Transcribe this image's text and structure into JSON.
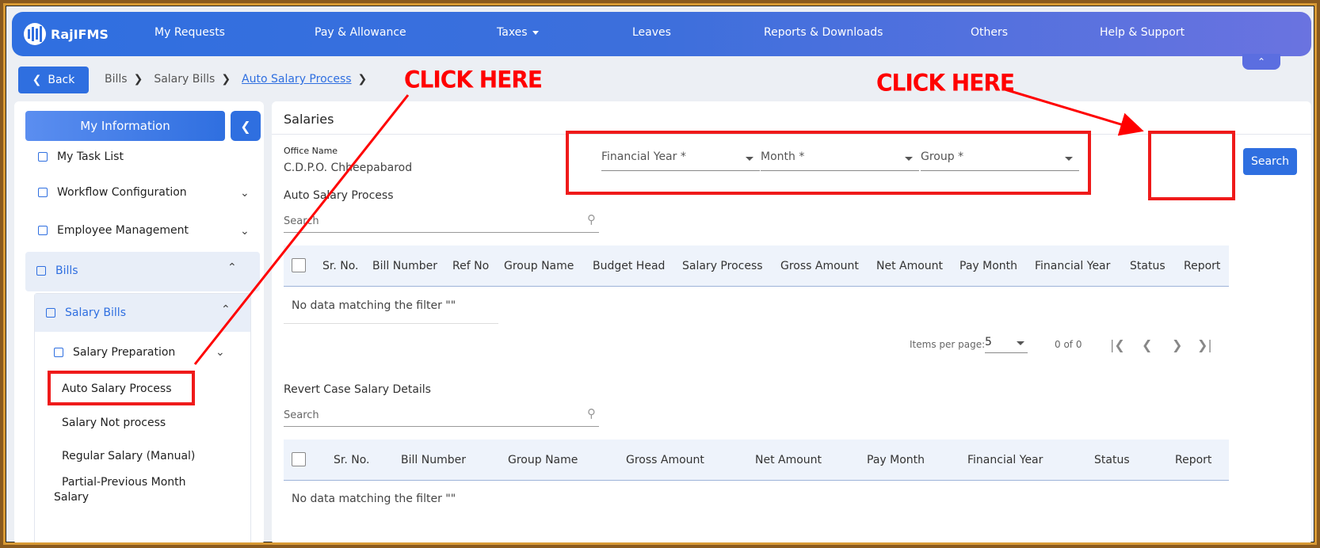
{
  "brand": {
    "name": "RajIFMS"
  },
  "nav": {
    "items": [
      "My Requests",
      "Pay & Allowance",
      "Taxes",
      "Leaves",
      "Reports & Downloads",
      "Others",
      "Help & Support"
    ]
  },
  "breadcrumb": {
    "back_label": "Back",
    "items": [
      "Bills",
      "Salary Bills",
      "Auto Salary Process"
    ]
  },
  "sidebar": {
    "my_info": "My Information",
    "items": {
      "task_list": "My Task List",
      "workflow": "Workflow Configuration",
      "employee": "Employee Management",
      "bills": "Bills",
      "salary_bills": "Salary Bills",
      "salary_preparation": "Salary Preparation",
      "auto_salary_process": "Auto Salary Process",
      "salary_not_process": "Salary Not process",
      "regular_salary": "Regular Salary (Manual)",
      "partial_prev_line1": "Partial-Previous Month",
      "partial_prev_line2": "Salary"
    }
  },
  "main": {
    "title": "Salaries",
    "office_label": "Office Name",
    "office_value": "C.D.P.O. Chheepabarod",
    "filters": {
      "financial_year": "Financial Year *",
      "month": "Month *",
      "group": "Group *"
    },
    "search_button": "Search",
    "auto_section": {
      "title": "Auto Salary Process",
      "search_placeholder": "Search",
      "columns": [
        "Sr. No.",
        "Bill Number",
        "Ref No",
        "Group Name",
        "Budget Head",
        "Salary Process",
        "Gross Amount",
        "Net Amount",
        "Pay Month",
        "Financial Year",
        "Status",
        "Report"
      ],
      "no_data": "No data matching the filter \"\"",
      "items_per_page_label": "Items per page:",
      "items_per_page_value": "5",
      "range": "0 of 0"
    },
    "revert_section": {
      "title": "Revert Case Salary Details",
      "search_placeholder": "Search",
      "columns": [
        "Sr. No.",
        "Bill Number",
        "Group Name",
        "Gross Amount",
        "Net Amount",
        "Pay Month",
        "Financial Year",
        "Status",
        "Report"
      ],
      "no_data": "No data matching the filter \"\""
    }
  },
  "annotations": {
    "click_here_1": "CLICK HERE",
    "click_here_2": "CLICK HERE",
    "color": "#ff0000"
  }
}
